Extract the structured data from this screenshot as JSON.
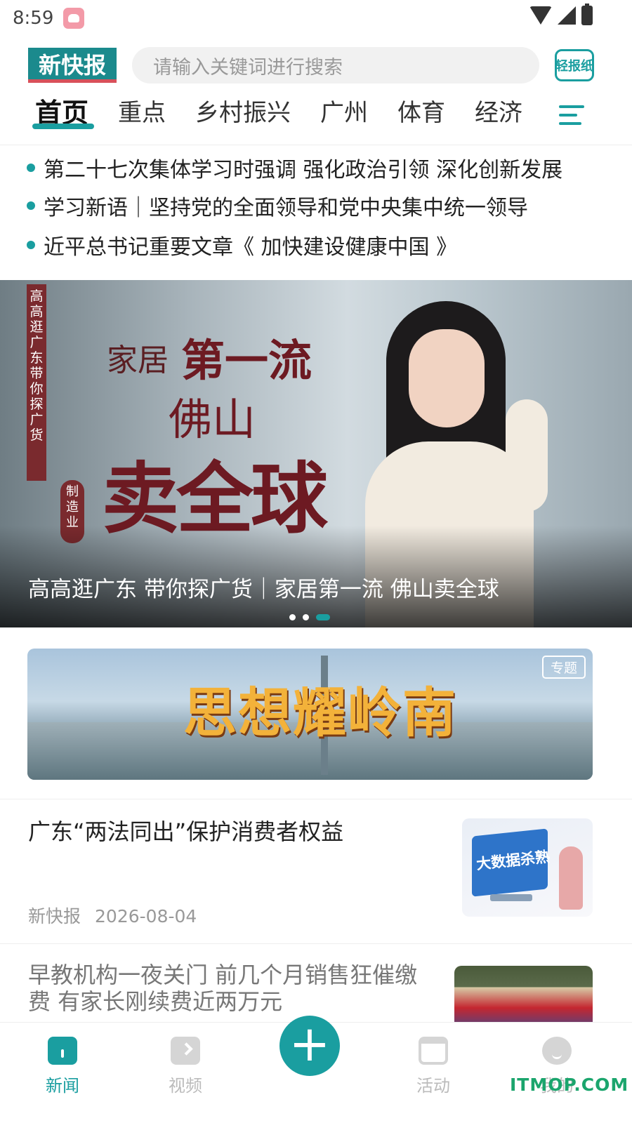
{
  "status_bar": {
    "time": "8:59"
  },
  "header": {
    "logo_text": "新快报",
    "search_placeholder": "请输入关键词进行搜索",
    "paper_button": "轻报纸"
  },
  "tabs": [
    "首页",
    "重点",
    "乡村振兴",
    "广州",
    "体育",
    "经济"
  ],
  "active_tab": "首页",
  "headlines": [
    "第二十七次集体学习时强调 强化政治引领 深化创新发展",
    "学习新语｜坚持党的全面领导和党中央集中统一领导",
    "近平总书记重要文章《 加快建设健康中国 》"
  ],
  "carousel": {
    "side_text": "高高逛广东 带你探广货",
    "word1": "家居",
    "word2": "第一流",
    "word3": "佛山",
    "word4": "卖全球",
    "seal": "制造业",
    "caption": "高高逛广东 带你探广货｜家居第一流 佛山卖全球",
    "slide_count": 3,
    "active_slide": 3
  },
  "banner": {
    "title": "思想耀岭南",
    "badge": "专题"
  },
  "articles": [
    {
      "title": "广东“两法同出”保护消费者权益",
      "source": "新快报",
      "date": "2026-08-04",
      "thumb_text": "大数据杀熟"
    },
    {
      "title": "早教机构一夜关门 前几个月销售狂催缴费 有家长刚续费近两万元"
    }
  ],
  "bottom_nav": {
    "items": [
      "新闻",
      "视频",
      "活动",
      "我的"
    ],
    "active": "新闻"
  },
  "watermark": "ITMOP.COM",
  "colors": {
    "accent": "#1a9ea0",
    "brand_red": "#d8505a",
    "watermark": "#1ba56d"
  }
}
